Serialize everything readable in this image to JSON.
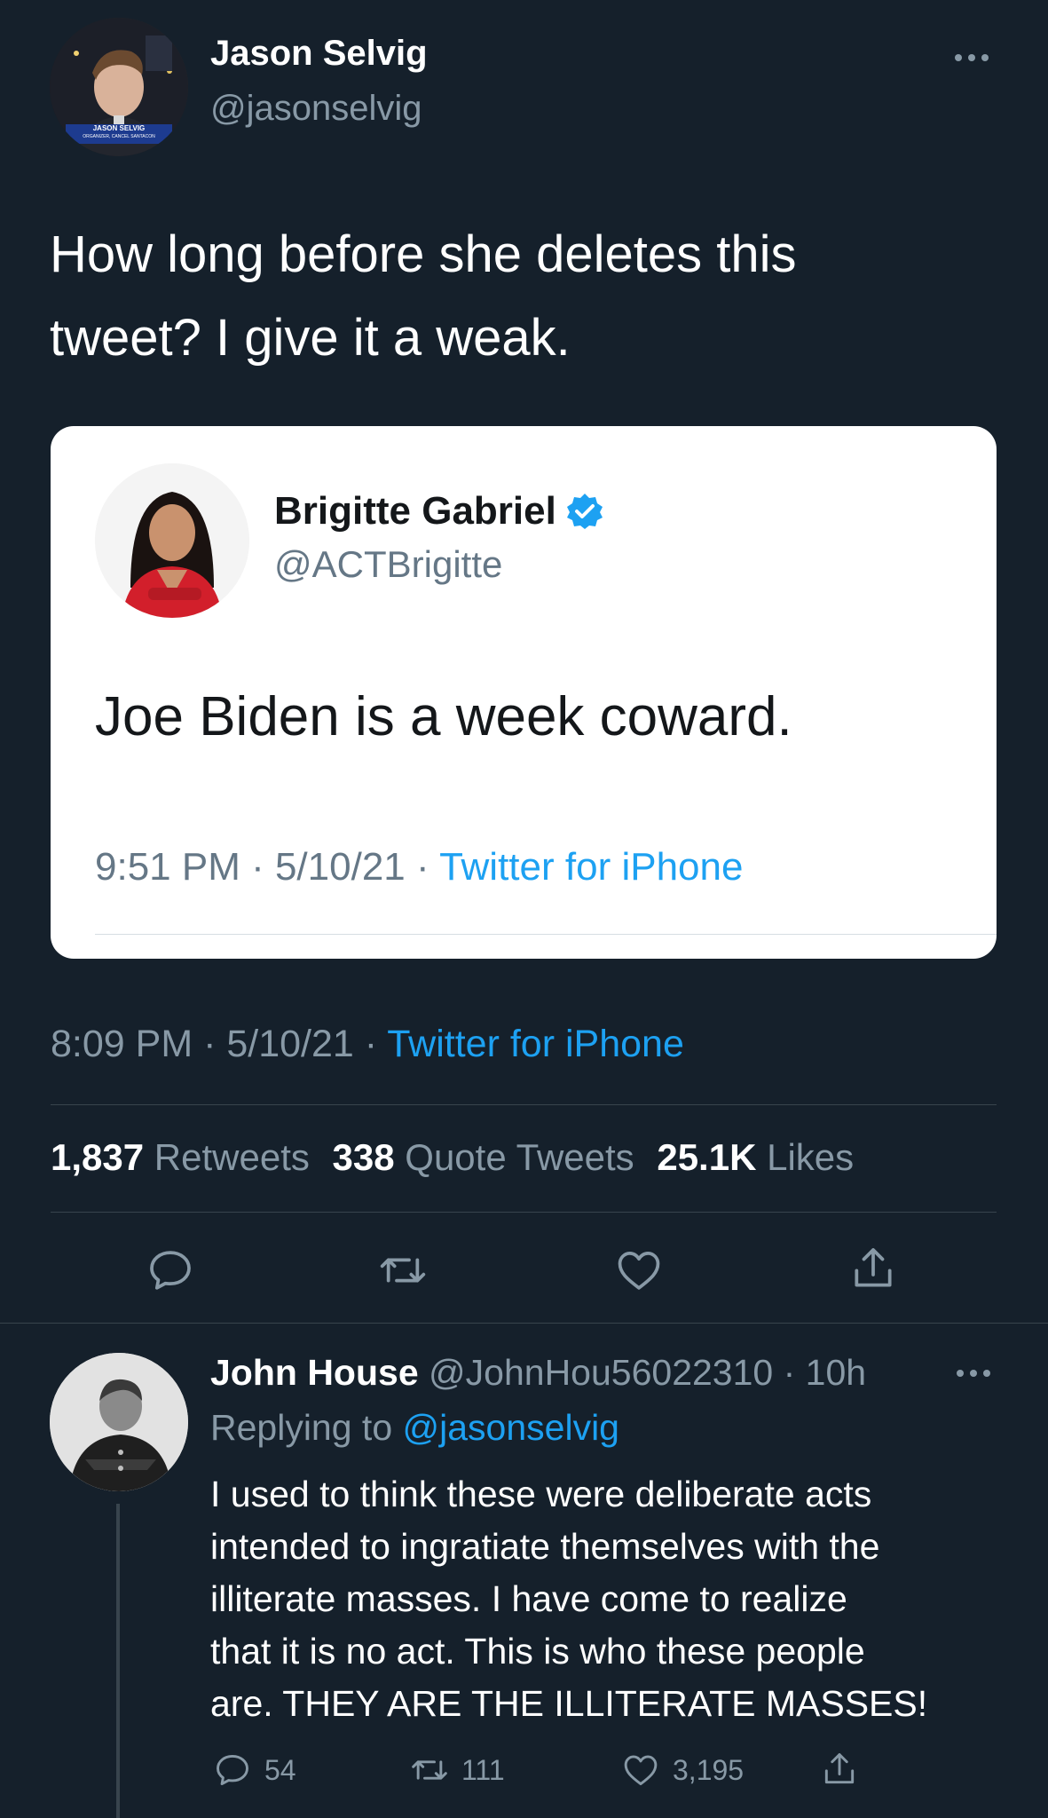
{
  "main_tweet": {
    "author_name": "Jason Selvig",
    "author_handle": "@jasonselvig",
    "avatar_caption": "JASON SELVIG",
    "avatar_subcaption": "ORGANIZER, CANCEL SANTACON",
    "text": "How long before she deletes this tweet? I give it a weak.",
    "timestamp": "8:09 PM · 5/10/21 · ",
    "source": "Twitter for iPhone",
    "more_icon": "more-horizontal-icon"
  },
  "quoted_tweet": {
    "author_name": "Brigitte Gabriel",
    "author_handle": "@ACTBrigitte",
    "verified_icon": "verified-badge-icon",
    "text": "Joe Biden is a week coward.",
    "timestamp": "9:51 PM · 5/10/21 · ",
    "source": "Twitter for iPhone"
  },
  "stats": {
    "retweets_count": "1,837",
    "retweets_label": "Retweets",
    "quotes_count": "338",
    "quotes_label": "Quote Tweets",
    "likes_count": "25.1K",
    "likes_label": "Likes"
  },
  "actions": [
    "reply-icon",
    "retweet-icon",
    "like-icon",
    "share-icon"
  ],
  "reply": {
    "author_name": "John House",
    "author_handle": "@JohnHou56022310",
    "time": " · 10h",
    "replying_prefix": "Replying to ",
    "replying_to": "@jasonselvig",
    "text_lines": [
      "I used to think these were deliberate acts",
      "intended to ingratiate themselves with the",
      "illiterate masses.  I have come to realize",
      "that it is no act.  This is who these people",
      "are.  THEY ARE THE ILLITERATE MASSES!"
    ],
    "reply_count": "54",
    "retweet_count": "111",
    "like_count": "3,195"
  },
  "colors": {
    "background": "#15202b",
    "accent": "#1da1f2",
    "muted": "#8899a6",
    "divider": "#38444d"
  }
}
